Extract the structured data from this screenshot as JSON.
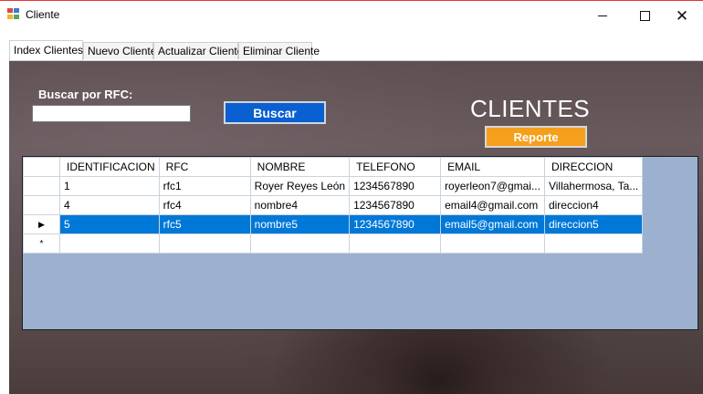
{
  "window": {
    "title": "Cliente",
    "icon": "form-icon",
    "controls": {
      "minimize": "minimize-icon",
      "maximize": "maximize-icon",
      "close": "close-icon",
      "close_glyph": "✕"
    }
  },
  "tabs": [
    {
      "label": "Index Clientes",
      "active": true
    },
    {
      "label": "Nuevo Cliente",
      "active": false
    },
    {
      "label": "Actualizar Cliente",
      "active": false
    },
    {
      "label": "Eliminar Cliente",
      "active": false
    }
  ],
  "search": {
    "label": "Buscar por RFC:",
    "value": "",
    "button_label": "Buscar"
  },
  "header": {
    "title": "CLIENTES",
    "report_button_label": "Reporte"
  },
  "grid": {
    "columns": [
      "IDENTIFICACION",
      "RFC",
      "NOMBRE",
      "TELEFONO",
      "EMAIL",
      "DIRECCION"
    ],
    "rows": [
      {
        "cells": [
          "1",
          "rfc1",
          "Royer Reyes León",
          "1234567890",
          "royerleon7@gmai...",
          "Villahermosa, Ta..."
        ],
        "selected": false,
        "current": false
      },
      {
        "cells": [
          "4",
          "rfc4",
          "nombre4",
          "1234567890",
          "email4@gmail.com",
          "direccion4"
        ],
        "selected": false,
        "current": false
      },
      {
        "cells": [
          "5",
          "rfc5",
          "nombre5",
          "1234567890",
          "email5@gmail.com",
          "direccion5"
        ],
        "selected": true,
        "current": true
      }
    ],
    "current_row_marker": "▶",
    "new_row_marker": "*"
  },
  "colors": {
    "accent_blue": "#0a5fd1",
    "selection_blue": "#0078d7",
    "report_orange": "#f5a01d",
    "grid_background": "#9bb1cf"
  }
}
